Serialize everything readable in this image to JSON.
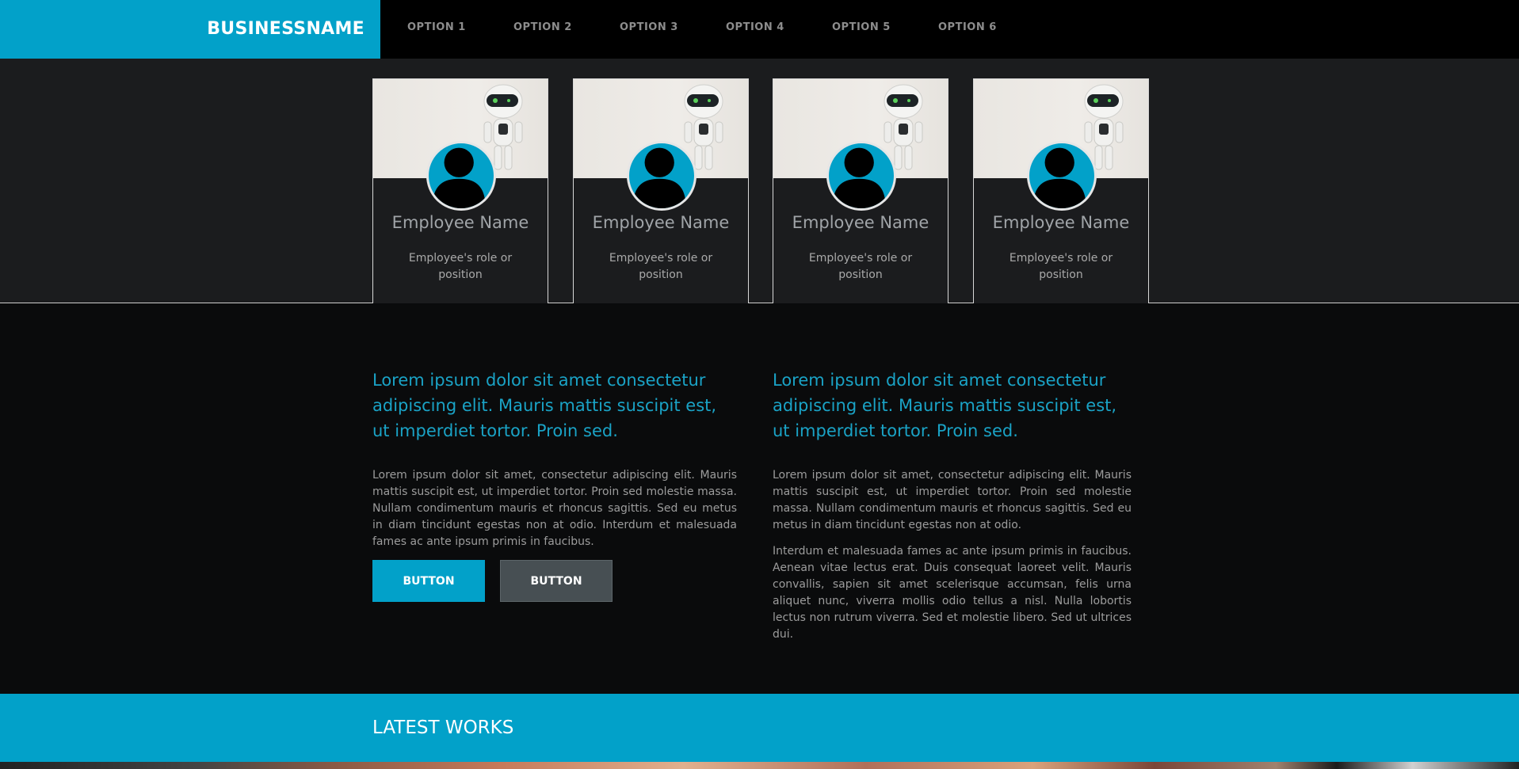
{
  "header": {
    "brand": "BUSINESSNAME",
    "nav": [
      "OPTION 1",
      "OPTION 2",
      "OPTION 3",
      "OPTION 4",
      "OPTION 5",
      "OPTION 6"
    ]
  },
  "team": [
    {
      "name": "Employee Name",
      "role": "Employee's role or position"
    },
    {
      "name": "Employee Name",
      "role": "Employee's role or position"
    },
    {
      "name": "Employee Name",
      "role": "Employee's role or position"
    },
    {
      "name": "Employee Name",
      "role": "Employee's role or position"
    }
  ],
  "columns": {
    "left": {
      "heading": "Lorem ipsum dolor sit amet consectetur adipiscing elit. Mauris mattis suscipit est, ut imperdiet tortor. Proin sed.",
      "paragraph": "Lorem ipsum dolor sit amet, consectetur adipiscing elit. Mauris mattis suscipit est, ut imperdiet tortor. Proin sed molestie massa. Nullam condimentum mauris et rhoncus sagittis. Sed eu metus in diam tincidunt egestas non at odio. Interdum et malesuada fames ac ante ipsum primis in faucibus.",
      "button_primary": "BUTTON",
      "button_secondary": "BUTTON"
    },
    "right": {
      "heading": "Lorem ipsum dolor sit amet consectetur adipiscing elit. Mauris mattis suscipit est, ut imperdiet tortor. Proin sed.",
      "paragraph1": "Lorem ipsum dolor sit amet, consectetur adipiscing elit. Mauris mattis suscipit est, ut imperdiet tortor. Proin sed molestie massa. Nullam condimentum mauris et rhoncus sagittis. Sed eu metus in diam tincidunt egestas non at odio.",
      "paragraph2": "Interdum et malesuada fames ac ante ipsum primis in faucibus. Aenean vitae lectus erat. Duis consequat laoreet velit. Mauris convallis, sapien sit amet scelerisque accumsan, felis urna aliquet nunc, viverra mollis odio tellus a nisl. Nulla lobortis lectus non rutrum viverra. Sed et molestie libero. Sed ut ultrices dui."
    }
  },
  "works": {
    "title": "LATEST WORKS"
  },
  "colors": {
    "accent": "#02a1c9",
    "header_bg": "#000000",
    "team_bg": "#1b1c1e",
    "content_bg": "#0a0b0c",
    "secondary_button": "#474f53"
  },
  "icons": {
    "avatar": "user-silhouette-icon",
    "photo": "robot-photo"
  }
}
